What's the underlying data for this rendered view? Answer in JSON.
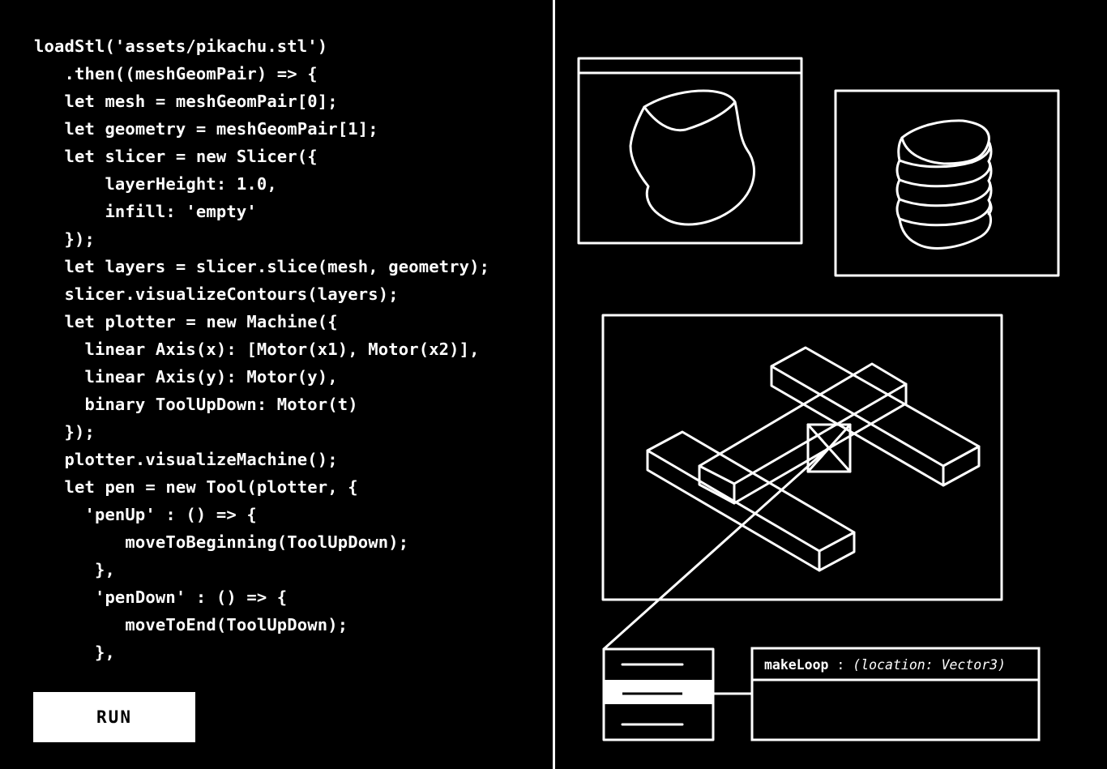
{
  "code_editor": {
    "lines": [
      "loadStl('assets/pikachu.stl')",
      "   .then((meshGeomPair) => {",
      "   let mesh = meshGeomPair[0];",
      "   let geometry = meshGeomPair[1];",
      "   let slicer = new Slicer({",
      "       layerHeight: 1.0,",
      "       infill: 'empty'",
      "   });",
      "   let layers = slicer.slice(mesh, geometry);",
      "   slicer.visualizeContours(layers);",
      "   let plotter = new Machine({",
      "     linear Axis(x): [Motor(x1), Motor(x2)],",
      "     linear Axis(y): Motor(y),",
      "     binary ToolUpDown: Motor(t)",
      "   });",
      "   plotter.visualizeMachine();",
      "   let pen = new Tool(plotter, {",
      "     'penUp' : () => {",
      "         moveToBeginning(ToolUpDown);",
      "      },",
      "      'penDown' : () => {",
      "         moveToEnd(ToolUpDown);",
      "      },"
    ]
  },
  "run_button": {
    "label": "RUN"
  },
  "inspector": {
    "function_name": "makeLoop",
    "separator": " : ",
    "params": "(location: Vector3)"
  },
  "colors": {
    "background": "#000000",
    "foreground": "#ffffff"
  },
  "icons": {
    "mesh_preview": "mesh-blob-icon",
    "layers_preview": "stacked-contours-icon",
    "machine_preview": "gantry-machine-icon",
    "list_panel": "list-lines-icon"
  }
}
